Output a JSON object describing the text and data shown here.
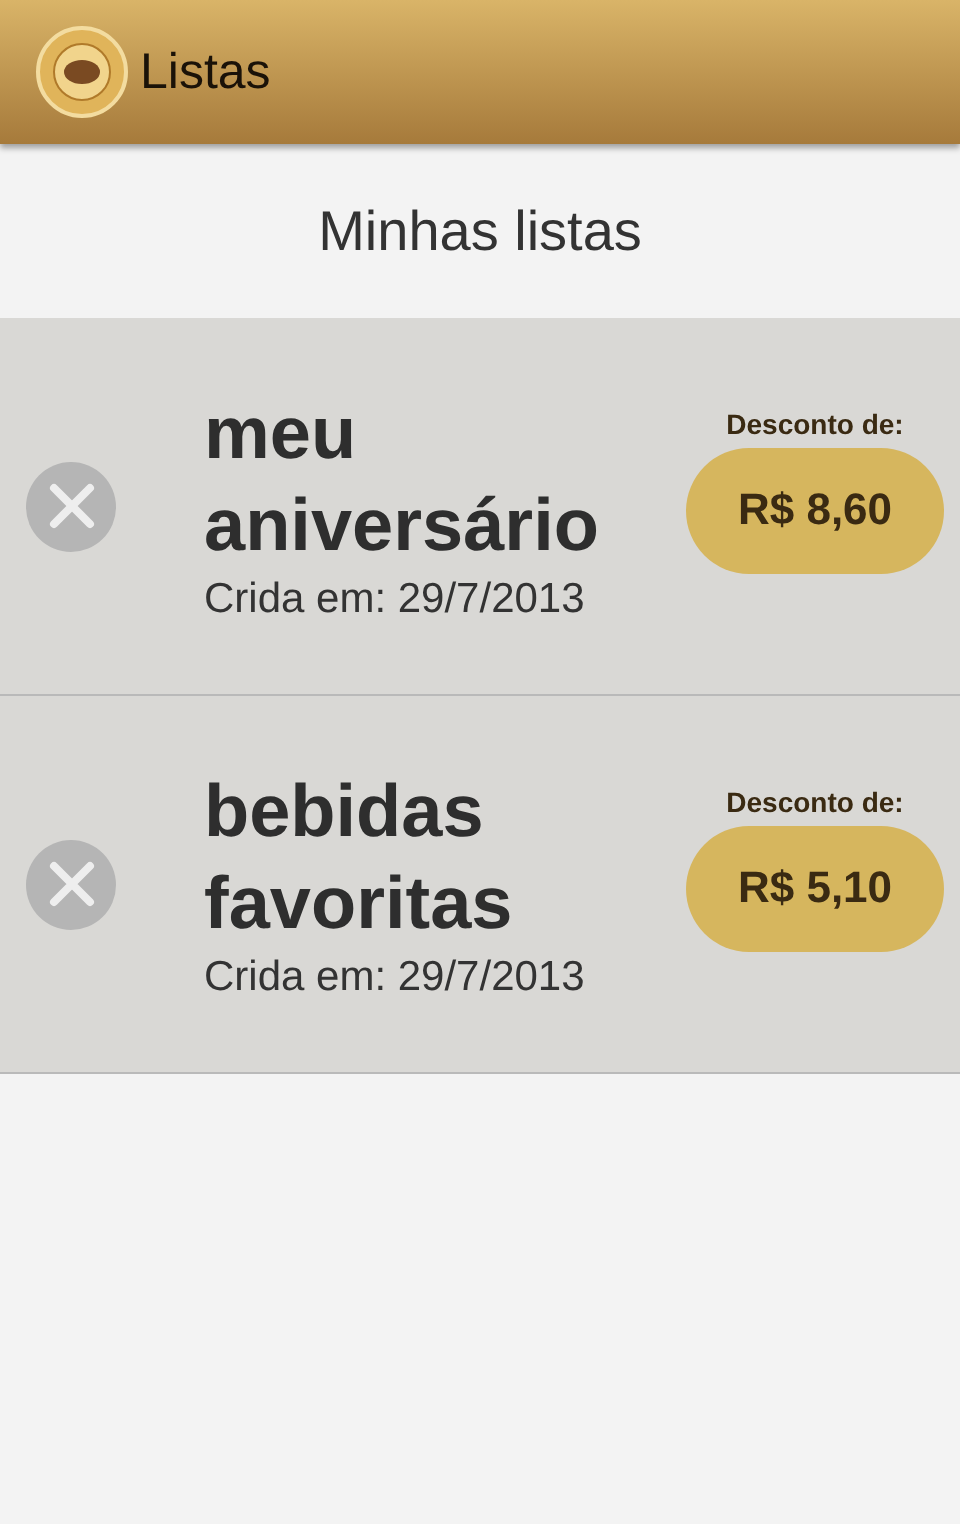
{
  "app_bar": {
    "title": "Listas"
  },
  "heading": "Minhas listas",
  "lists": [
    {
      "name": "meu aniversário",
      "created": "Crida em: 29/7/2013",
      "discount_label": "Desconto de:",
      "discount": "R$ 8,60"
    },
    {
      "name": "bebidas favoritas",
      "created": "Crida em: 29/7/2013",
      "discount_label": "Desconto de:",
      "discount": "R$ 5,10"
    }
  ]
}
